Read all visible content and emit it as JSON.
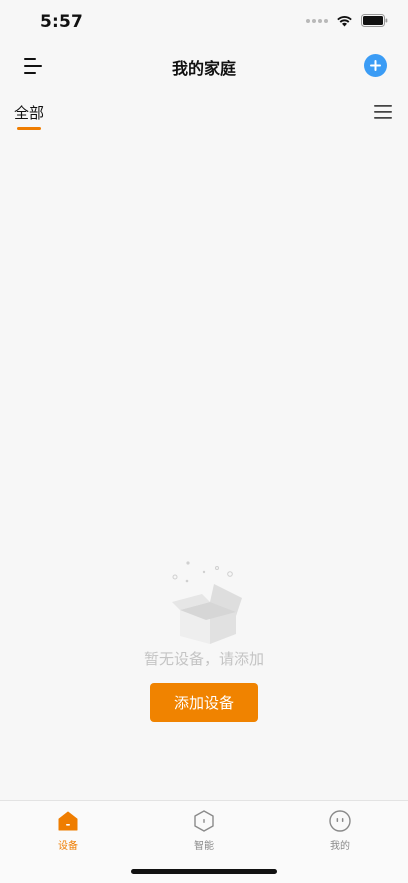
{
  "status_bar": {
    "time": "5:57"
  },
  "nav": {
    "title": "我的家庭"
  },
  "tabs": {
    "all_label": "全部"
  },
  "empty_state": {
    "message": "暂无设备，请添加",
    "button_label": "添加设备"
  },
  "tab_bar": {
    "items": [
      {
        "label": "设备",
        "icon": "home-icon",
        "active": true
      },
      {
        "label": "智能",
        "icon": "hexagon-icon",
        "active": false
      },
      {
        "label": "我的",
        "icon": "face-icon",
        "active": false
      }
    ]
  },
  "colors": {
    "accent": "#f08300",
    "add_button": "#3b9cf5",
    "inactive_tab": "#8a8a8a",
    "empty_text": "#c4c4c4",
    "background": "#f7f7f7"
  }
}
